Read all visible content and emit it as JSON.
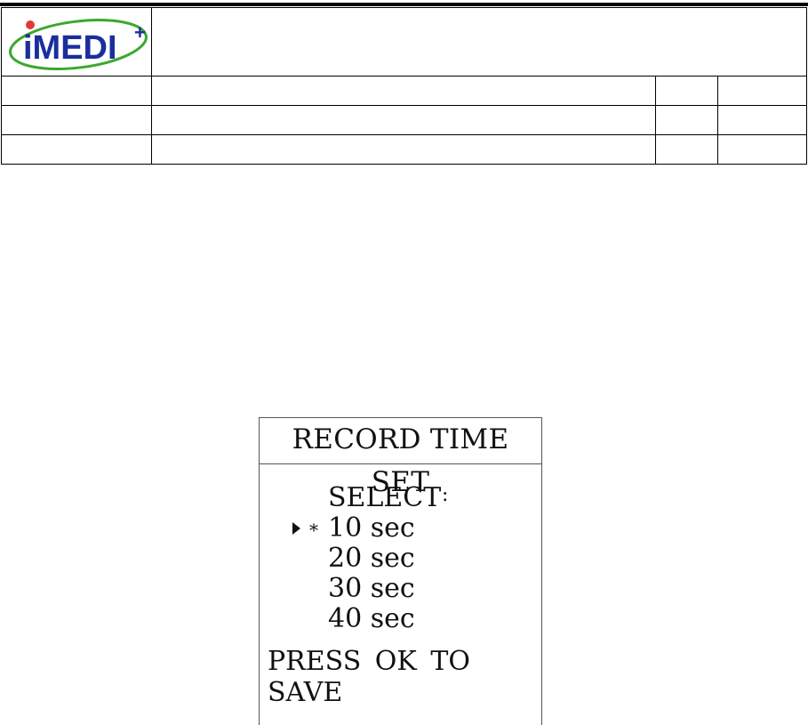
{
  "header": {
    "logo_text": "iMEDI",
    "logo_sup": "+",
    "colors": {
      "logo_blue": "#1a2e9c",
      "logo_green": "#3aa82e",
      "logo_dot": "#e53935"
    }
  },
  "screen": {
    "title": "RECORD TIME SET",
    "select_label": "SELECT",
    "select_colon": ":",
    "selected_marker": "*",
    "cursor_icon": "triangle-right-icon",
    "options": [
      "10 sec",
      "20 sec",
      "30 sec",
      "40 sec"
    ],
    "selected_index": 0,
    "footer": "PRESS  OK  TO  SAVE"
  }
}
